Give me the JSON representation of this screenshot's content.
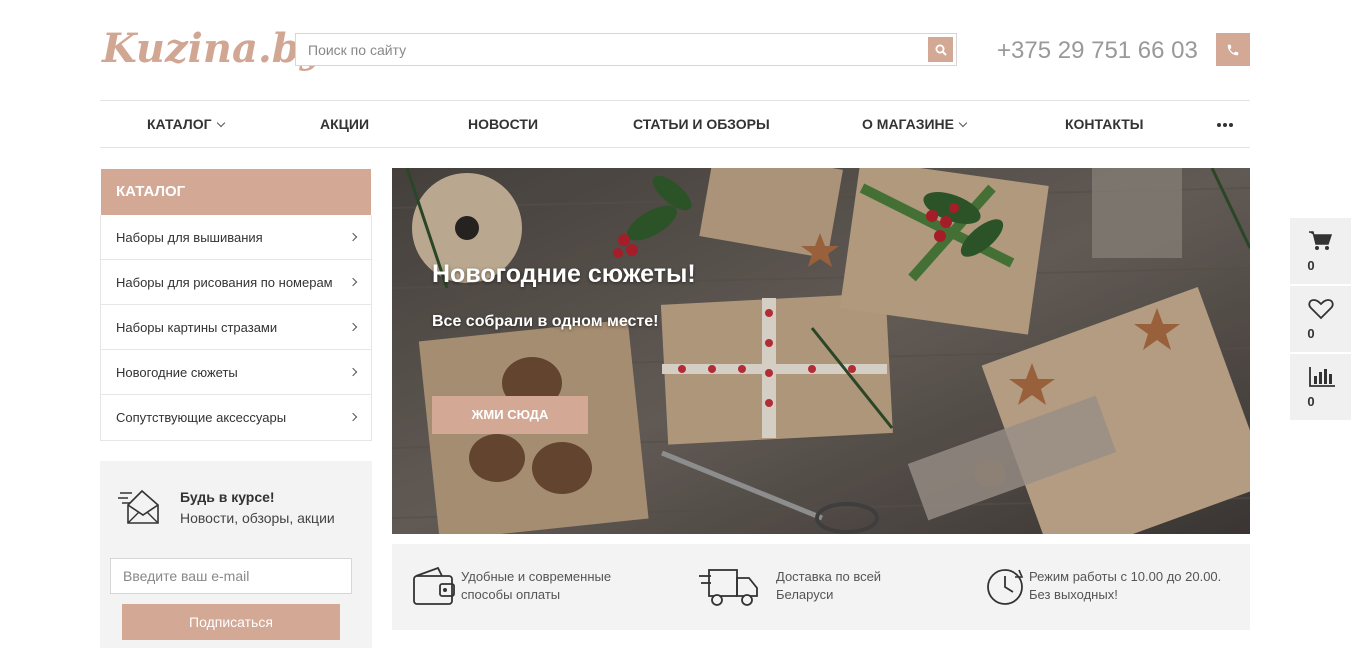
{
  "header": {
    "logo_text": "Kuzina.by",
    "search_placeholder": "Поиск по сайту",
    "phone": "+375 29 751 66 03"
  },
  "nav": {
    "items": [
      {
        "label": "Каталог"
      },
      {
        "label": "Акции"
      },
      {
        "label": "Новости"
      },
      {
        "label": "Статьи и обзоры"
      },
      {
        "label": "О магазине"
      },
      {
        "label": "Контакты"
      }
    ]
  },
  "catalog": {
    "title": "Каталог",
    "items": [
      {
        "label": "Наборы для вышивания"
      },
      {
        "label": "Наборы для рисования по номерам"
      },
      {
        "label": "Наборы картины стразами"
      },
      {
        "label": "Новогодние сюжеты"
      },
      {
        "label": "Сопутствующие аксессуары"
      }
    ]
  },
  "subscribe": {
    "title": "Будь в курсе!",
    "text": "Новости, обзоры, акции",
    "email_placeholder": "Введите ваш e-mail",
    "button": "Подписаться"
  },
  "banner": {
    "title": "Новогодние сюжеты!",
    "subtitle": "Все собрали в одном месте!",
    "button": "Жми сюда"
  },
  "features": [
    {
      "line1": "Удобные и современные",
      "line2": "способы оплаты"
    },
    {
      "line1": "Доставка по всей",
      "line2": "Беларуси"
    },
    {
      "line1": "Режим работы с 10.00 до 20.00.",
      "line2": "Без выходных!"
    }
  ],
  "side_panel": {
    "cart_count": "0",
    "wishlist_count": "0",
    "compare_count": "0"
  },
  "colors": {
    "accent": "#d3a895",
    "panel_bg": "#f3f3f3"
  }
}
